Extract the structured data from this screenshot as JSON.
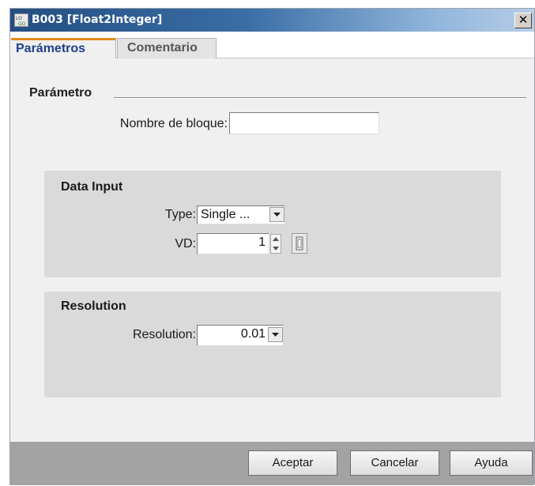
{
  "window": {
    "title": "B003 [Float2Integer]",
    "close_glyph": "✕",
    "icon": "logo-app-icon"
  },
  "tabs": [
    {
      "label": "Parámetros",
      "active": true
    },
    {
      "label": "Comentario",
      "active": false
    }
  ],
  "parameter_group": {
    "caption": "Parámetro",
    "block_name_label": "Nombre de bloque:",
    "block_name_value": ""
  },
  "data_input": {
    "title": "Data Input",
    "type_label": "Type:",
    "type_value": "Single ...",
    "vd_label": "VD:",
    "vd_value": "1"
  },
  "resolution": {
    "title": "Resolution",
    "label": "Resolution:",
    "value": "0.01"
  },
  "buttons": {
    "accept": "Aceptar",
    "cancel": "Cancelar",
    "help": "Ayuda"
  },
  "colors": {
    "titlebar": "#234e82",
    "active_tab_text": "#1e3f8b",
    "tab_accent": "#e88a1c",
    "panel": "#dadada",
    "footer": "#a3a3a3"
  }
}
